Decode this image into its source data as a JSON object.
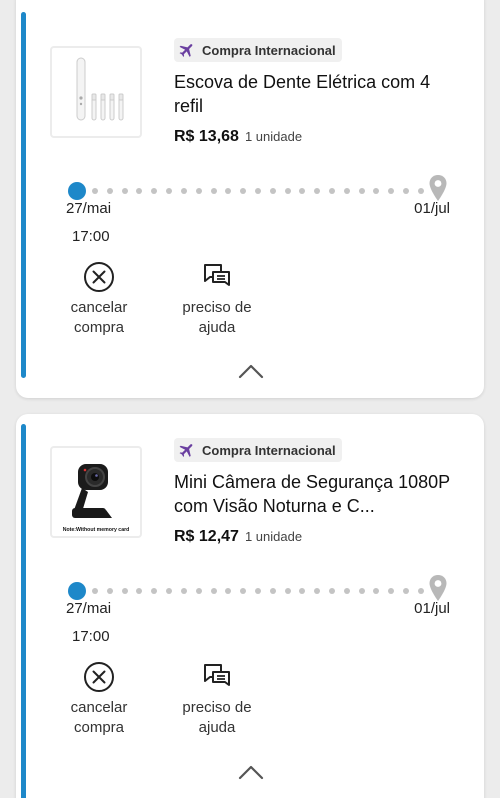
{
  "orders": [
    {
      "badge": "Compra Internacional",
      "title": "Escova de Dente Elétrica com 4 refil",
      "price": "R$ 13,68",
      "quantity": "1 unidade",
      "start_date": "27/mai",
      "start_time": "17:00",
      "end_date": "01/jul",
      "cancel_line1": "cancelar",
      "cancel_line2": "compra",
      "help_line1": "preciso de",
      "help_line2": "ajuda"
    },
    {
      "badge": "Compra Internacional",
      "title": "Mini Câmera de Segurança 1080P com Visão Noturna e C...",
      "price": "R$ 12,47",
      "quantity": "1 unidade",
      "start_date": "27/mai",
      "start_time": "17:00",
      "end_date": "01/jul",
      "cancel_line1": "cancelar",
      "cancel_line2": "compra",
      "help_line1": "preciso de",
      "help_line2": "ajuda",
      "image_caption": "Note:Without memory card"
    }
  ],
  "colors": {
    "accent": "#1e88c9",
    "badge_icon": "#6a3fa0",
    "dot": "#c4c4c4"
  },
  "icons": [
    "plane-icon",
    "location-pin-icon",
    "cancel-x-icon",
    "chat-help-icon",
    "chevron-up-icon"
  ]
}
